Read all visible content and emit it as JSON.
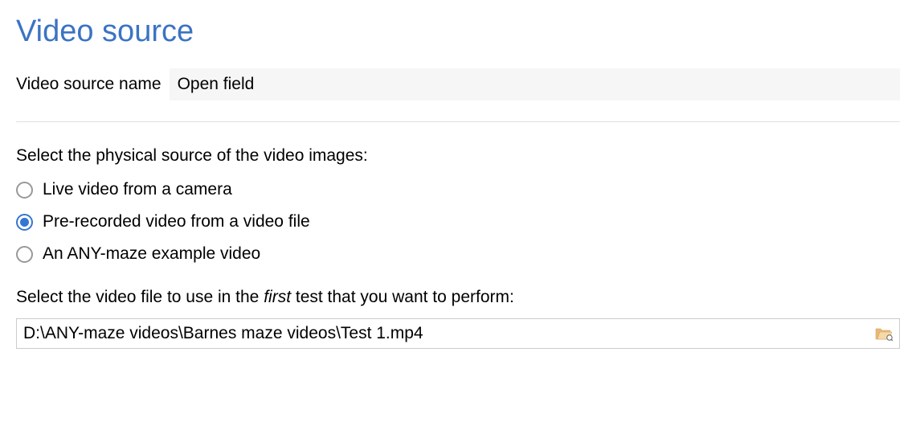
{
  "heading": "Video source",
  "nameRow": {
    "label": "Video source name",
    "value": "Open field"
  },
  "sourceSection": {
    "label": "Select the physical source of the video images:",
    "options": [
      {
        "label": "Live video from a camera",
        "selected": false
      },
      {
        "label": "Pre-recorded video from a video file",
        "selected": true
      },
      {
        "label": "An ANY-maze example video",
        "selected": false
      }
    ]
  },
  "fileSection": {
    "labelPrefix": "Select the video file to use in the ",
    "labelItalic": "first",
    "labelSuffix": " test that you want to perform:",
    "value": "D:\\ANY-maze videos\\Barnes maze videos\\Test 1.mp4"
  }
}
